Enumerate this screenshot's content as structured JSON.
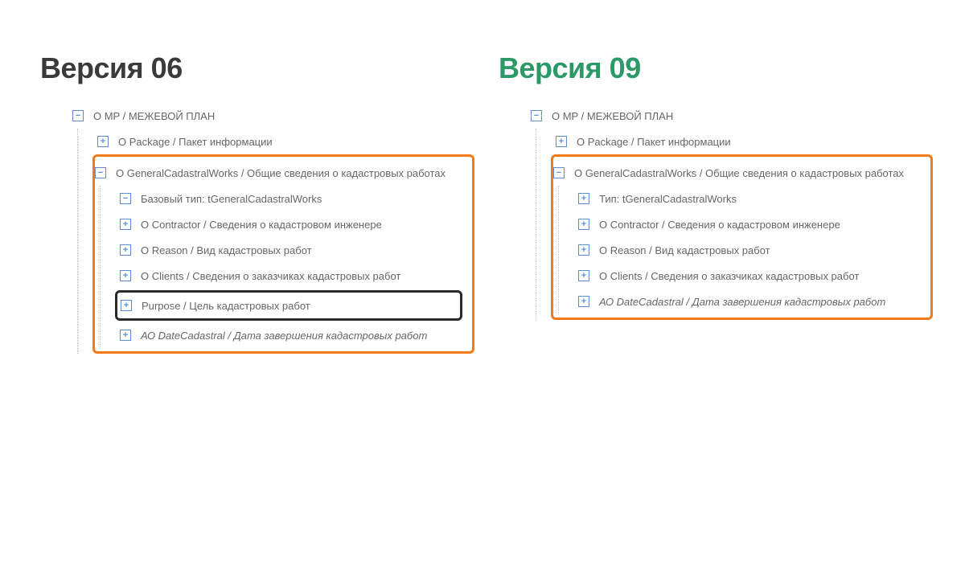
{
  "left": {
    "heading": "Версия 06",
    "root": "О MP / МЕЖЕВОЙ ПЛАН",
    "package": "О Package / Пакет информации",
    "gcw": "О GeneralCadastralWorks / Общие сведения о кадастровых работах",
    "type": "Базовый тип: tGeneralCadastralWorks",
    "contractor": "О Contractor / Сведения о кадастровом инженере",
    "reason": "О Reason / Вид кадастровых работ",
    "clients": "О Clients / Сведения о заказчиках кадастровых работ",
    "purpose": "Purpose / Цель кадастровых работ",
    "date": "АО DateCadastral / Дата завершения кадастровых работ"
  },
  "right": {
    "heading": "Версия 09",
    "root": "О MP / МЕЖЕВОЙ ПЛАН",
    "package": "О Package / Пакет информации",
    "gcw": "О GeneralCadastralWorks / Общие сведения о кадастровых работах",
    "type": "Тип: tGeneralCadastralWorks",
    "contractor": "О Contractor / Сведения о кадастровом инженере",
    "reason": "О Reason / Вид кадастровых работ",
    "clients": "О Clients / Сведения о заказчиках кадастровых работ",
    "date": "АО DateCadastral / Дата завершения кадастровых работ"
  },
  "glyph": {
    "plus": "+",
    "minus": "−"
  }
}
